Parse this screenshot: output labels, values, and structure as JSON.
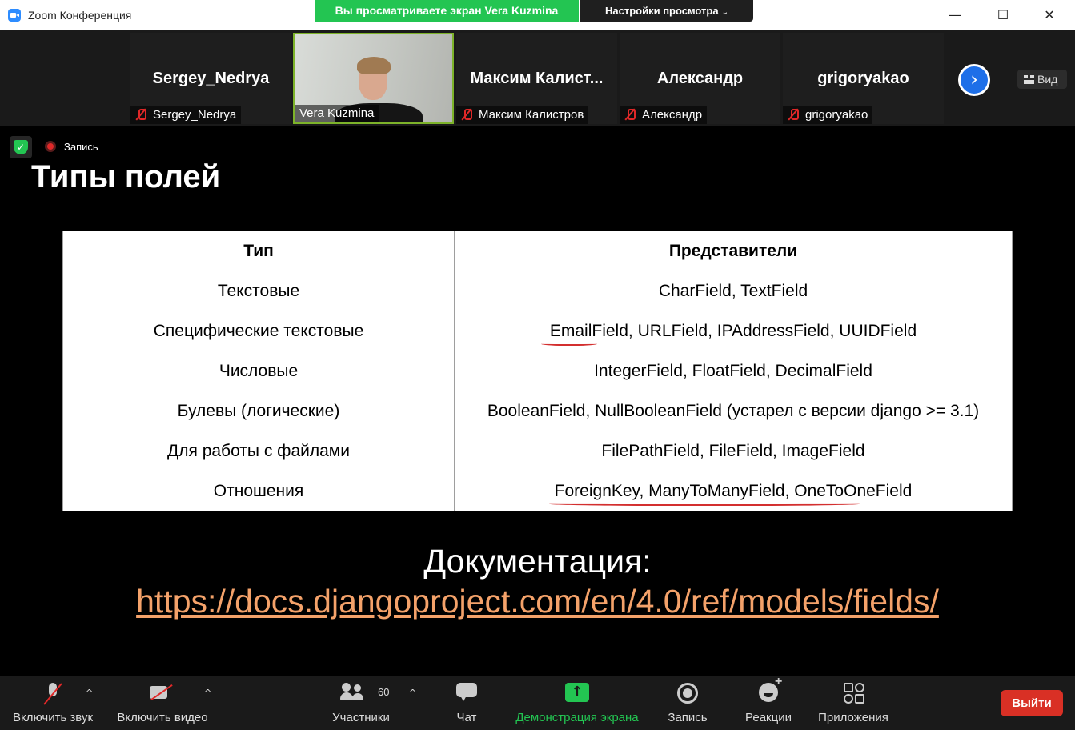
{
  "window": {
    "title": "Zoom Конференция",
    "share_banner": "Вы просматриваете экран Vera Kuzmina",
    "view_options": "Настройки просмотра",
    "controls": {
      "minimize": "—",
      "maximize": "☐",
      "close": "✕"
    }
  },
  "participants": [
    {
      "big_name": "Sergey_Nedrya",
      "label": "Sergey_Nedrya",
      "muted": true,
      "video": false
    },
    {
      "big_name": "",
      "label": "Vera Kuzmina",
      "muted": false,
      "video": true
    },
    {
      "big_name": "Максим  Калист...",
      "label": "Максим Калистров",
      "muted": true,
      "video": false
    },
    {
      "big_name": "Александр",
      "label": "Александр",
      "muted": true,
      "video": false
    },
    {
      "big_name": "grigoryakao",
      "label": "grigoryakao",
      "muted": true,
      "video": false
    }
  ],
  "strip": {
    "next_icon": "›",
    "view_label": "Вид"
  },
  "status": {
    "recording_label": "Запись"
  },
  "slide": {
    "title": "Типы полей",
    "table": {
      "headers": [
        "Тип",
        "Представители"
      ],
      "rows": [
        [
          "Текстовые",
          "CharField, TextField"
        ],
        [
          "Специфические текстовые",
          "EmailField, URLField, IPAddressField, UUIDField"
        ],
        [
          "Числовые",
          "IntegerField, FloatField, DecimalField"
        ],
        [
          "Булевы (логические)",
          "BooleanField, NullBooleanField (устарел с версии django >= 3.1)"
        ],
        [
          "Для работы с файлами",
          "FilePathField, FileField, ImageField"
        ],
        [
          "Отношения",
          "ForeignKey, ManyToManyField, OneToOneField"
        ]
      ]
    },
    "doc_label": "Документация:",
    "doc_link": "https://docs.djangoproject.com/en/4.0/ref/models/fields/"
  },
  "toolbar": {
    "unmute": "Включить звук",
    "start_video": "Включить видео",
    "participants": "Участники",
    "participants_count": "60",
    "chat": "Чат",
    "share_screen": "Демонстрация экрана",
    "record": "Запись",
    "reactions": "Реакции",
    "apps": "Приложения",
    "leave": "Выйти",
    "caret": "^",
    "share_icon": "↑"
  },
  "colors": {
    "share_green": "#23c552",
    "leave_red": "#d93025",
    "link_orange": "#f4a26a",
    "accent_blue": "#1e6fe8"
  }
}
